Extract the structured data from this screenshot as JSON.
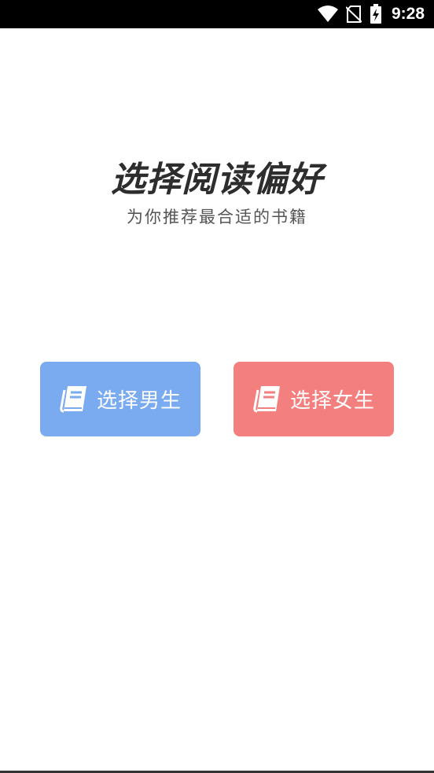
{
  "status_bar": {
    "time": "9:28",
    "icons": [
      "wifi-icon",
      "no-sim-icon",
      "battery-charging-icon"
    ]
  },
  "header": {
    "title": "选择阅读偏好",
    "subtitle": "为你推荐最合适的书籍"
  },
  "choices": {
    "male": {
      "label": "选择男生",
      "icon": "book-icon",
      "color": "#7aaaf0"
    },
    "female": {
      "label": "选择女生",
      "icon": "book-icon",
      "color": "#f37f7f"
    }
  }
}
